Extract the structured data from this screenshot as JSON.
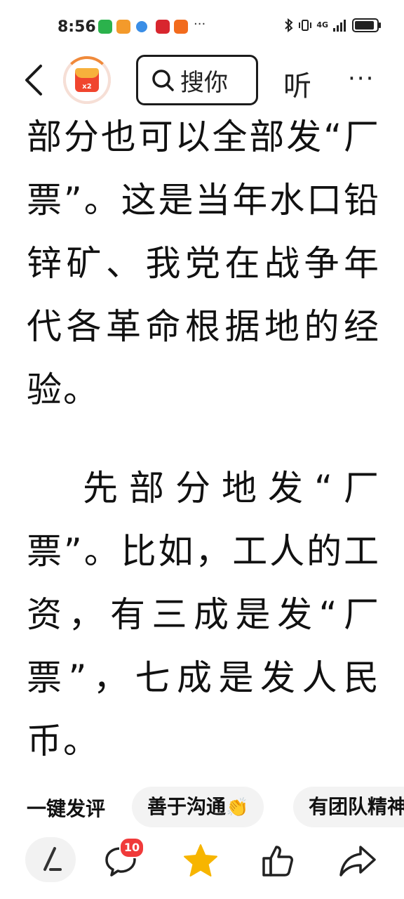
{
  "status_bar": {
    "time": "8:56",
    "more": "···",
    "network": "4G",
    "battery_level": 0.78
  },
  "top_nav": {
    "redpacket_badge": "x2",
    "search_label": "搜你",
    "listen_label": "听",
    "more_label": "···"
  },
  "article": {
    "paragraph_1": "部分也可以全部发“厂票”。这是当年水口铅锌矿、我党在战争年代各革命根据地的经验。",
    "paragraph_2": "先部分地发“厂票”。比如，工人的工资，有三成是发“厂票”，七成是发人民币。"
  },
  "quick_comment": {
    "label": "一键发评",
    "chips": [
      "善于沟通",
      "有团队精神"
    ]
  },
  "bottom_bar": {
    "comment_count": "10"
  },
  "colors": {
    "accent_red": "#f03a3a",
    "star_yellow": "#f7b500",
    "text": "#111111"
  },
  "icons": [
    "back-icon",
    "redpacket-icon",
    "search-icon",
    "write-icon",
    "comment-icon",
    "star-icon",
    "like-icon",
    "share-icon"
  ]
}
